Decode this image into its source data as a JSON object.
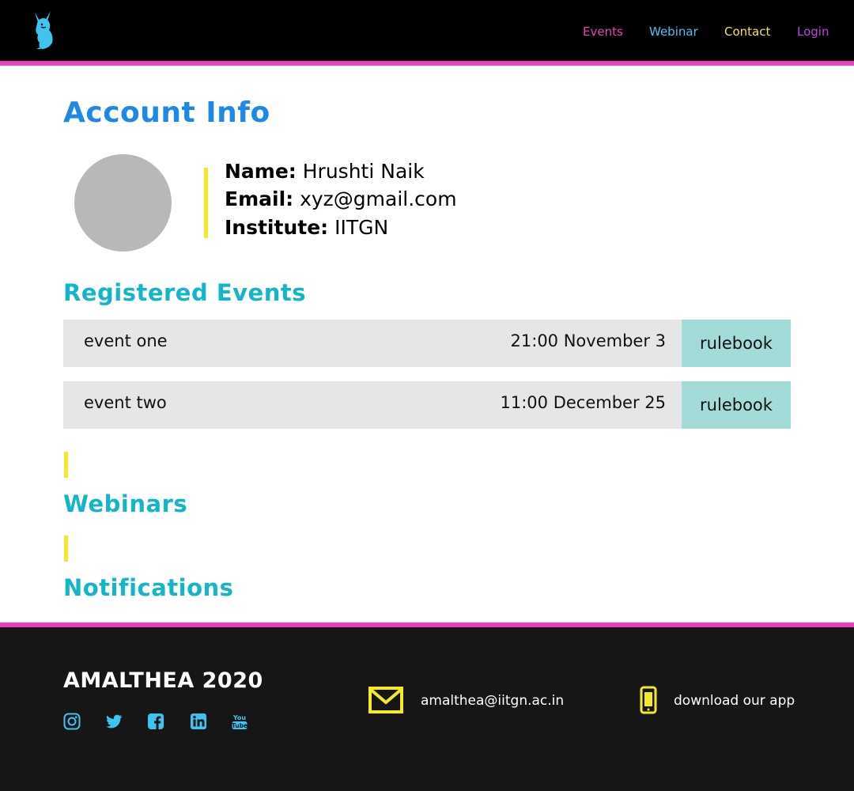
{
  "nav": {
    "items": [
      {
        "label": "Events",
        "color": "#ec3fbb"
      },
      {
        "label": "Webinar",
        "color": "#3fc4f0"
      },
      {
        "label": "Contact",
        "color": "#f5e926"
      },
      {
        "label": "Login",
        "color": "#c93fe0"
      }
    ]
  },
  "colors": {
    "accent_pink": "#ec3fbb",
    "heading_blue": "#1e88e5",
    "section_teal": "#13b5c8",
    "bar_yellow": "#f5e926",
    "rulebook_bg": "#a3dbd9",
    "footer_bg": "#161616",
    "social_icon": "#3fc4f0"
  },
  "account": {
    "title": "Account Info",
    "name_label": "Name:",
    "name": "Hrushti Naik",
    "email_label": "Email:",
    "email": "xyz@gmail.com",
    "institute_label": "Institute:",
    "institute": "IITGN"
  },
  "registered": {
    "title": "Registered Events",
    "events": [
      {
        "name": "event one",
        "datetime": "21:00 November 3",
        "action": "rulebook"
      },
      {
        "name": "event two",
        "datetime": "11:00 December 25",
        "action": "rulebook"
      }
    ]
  },
  "webinars": {
    "title": "Webinars"
  },
  "notifications": {
    "title": "Notifications"
  },
  "footer": {
    "brand": "AMALTHEA 2020",
    "socials": [
      "instagram-icon",
      "twitter-icon",
      "facebook-icon",
      "linkedin-icon",
      "youtube-icon"
    ],
    "email": "amalthea@iitgn.ac.in",
    "app": "download our app"
  }
}
